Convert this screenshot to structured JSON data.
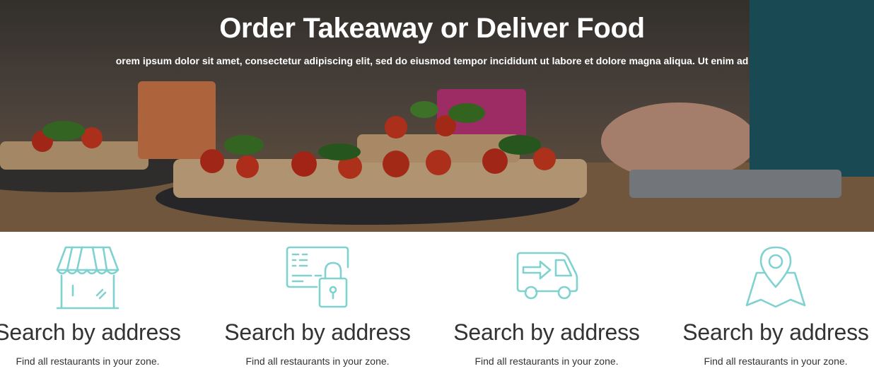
{
  "hero": {
    "title": "Order Takeaway or Deliver Food",
    "subtitle": "orem ipsum dolor sit amet, consectetur adipiscing elit, sed do eiusmod tempor incididunt ut labore et dolore magna aliqua. Ut enim ad"
  },
  "features": [
    {
      "icon": "storefront-icon",
      "title": "Search by address",
      "text": "Find all restaurants in your zone."
    },
    {
      "icon": "card-lock-icon",
      "title": "Search by address",
      "text": "Find all restaurants in your zone."
    },
    {
      "icon": "delivery-van-icon",
      "title": "Search by address",
      "text": "Find all restaurants in your zone."
    },
    {
      "icon": "map-pin-icon",
      "title": "Search by address",
      "text": "Find all restaurants in your zone."
    }
  ],
  "colors": {
    "accent": "#7fd2d0",
    "text": "#333333",
    "hero_text": "#ffffff"
  }
}
